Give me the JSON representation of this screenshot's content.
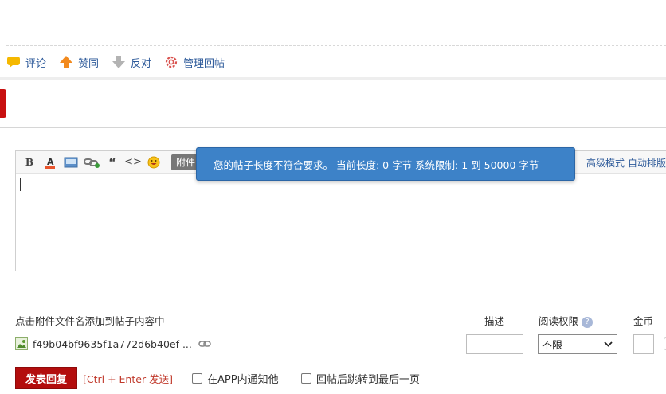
{
  "actions": {
    "comment": "评论",
    "agree": "赞同",
    "oppose": "反对",
    "manage": "管理回帖"
  },
  "editor": {
    "attach_label": "附件",
    "advanced_mode": "高级模式",
    "auto_format": "自动排版"
  },
  "toast": {
    "message": "您的帖子长度不符合要求。 当前长度: 0 字节 系统限制: 1 到 50000 字节"
  },
  "attachments": {
    "hint": "点击附件文件名添加到帖子内容中",
    "col_desc": "描述",
    "col_permission": "阅读权限",
    "col_coins": "金币",
    "file_name": "f49b04bf9635f1a772d6b40ef ...",
    "permission_value": "不限"
  },
  "footer": {
    "submit_label": "发表回复",
    "shortcut": "[Ctrl + Enter 发送]",
    "notify_app": "在APP内通知他",
    "jump_last": "回帖后跳转到最后一页"
  },
  "colors": {
    "toast_bg": "#3d82c8",
    "submit_bg": "#b30d0d",
    "link": "#2d5a9a"
  }
}
